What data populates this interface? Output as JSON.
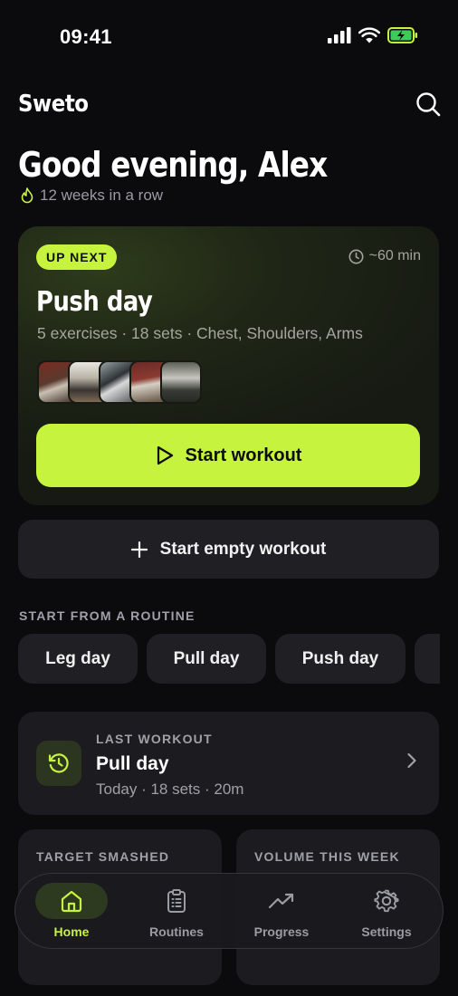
{
  "status": {
    "time": "09:41"
  },
  "app": {
    "title": "Sweto"
  },
  "greeting": {
    "text": "Good evening, Alex",
    "streak": "12 weeks in a row"
  },
  "up_next": {
    "badge": "UP NEXT",
    "duration": "~60 min",
    "name": "Push day",
    "meta": "5 exercises · 18 sets · Chest, Shoulders, Arms",
    "thumbnails": [
      "exercise-1",
      "exercise-2",
      "exercise-3",
      "exercise-4",
      "exercise-5"
    ],
    "start_label": "Start workout"
  },
  "empty_workout": {
    "label": "Start empty workout"
  },
  "routines": {
    "section_label": "START FROM A ROUTINE",
    "chips": [
      "Leg day",
      "Pull day",
      "Push day"
    ]
  },
  "last_workout": {
    "label": "LAST WORKOUT",
    "name": "Pull day",
    "meta": "Today · 18 sets · 20m"
  },
  "stats": {
    "target": {
      "label": "TARGET SMASHED"
    },
    "volume": {
      "label": "VOLUME THIS WEEK"
    }
  },
  "tabbar": {
    "items": [
      {
        "label": "Home",
        "icon": "home-icon",
        "active": true
      },
      {
        "label": "Routines",
        "icon": "clipboard-icon",
        "active": false
      },
      {
        "label": "Progress",
        "icon": "trend-icon",
        "active": false
      },
      {
        "label": "Settings",
        "icon": "gear-icon",
        "active": false
      }
    ]
  },
  "colors": {
    "accent": "#c6f33e",
    "background": "#0b0b0d",
    "card": "#1f1f24"
  }
}
